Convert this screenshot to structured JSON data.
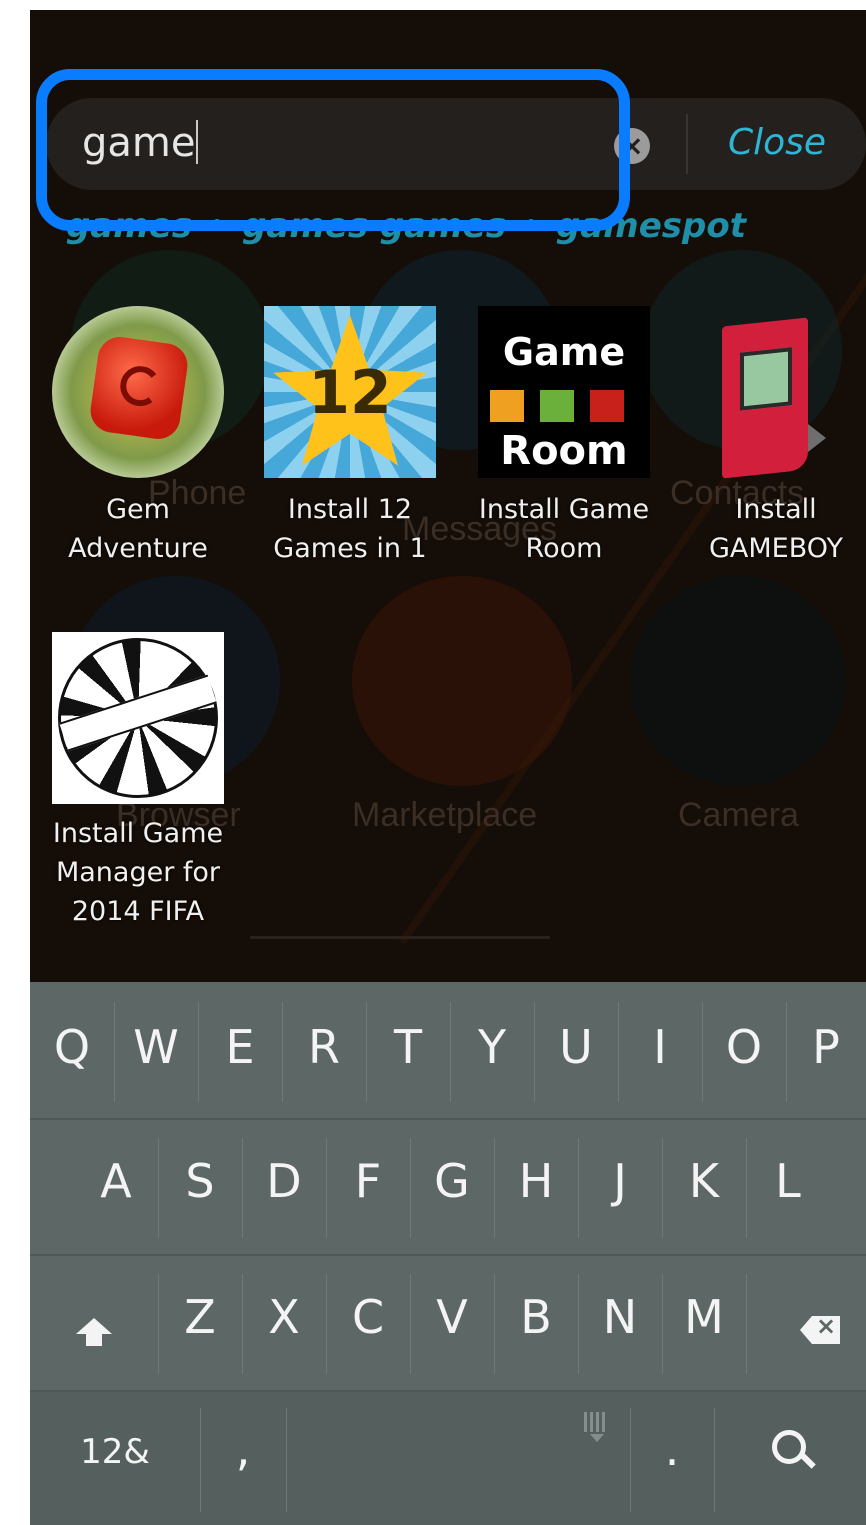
{
  "search": {
    "query": "game",
    "close_label": "Close"
  },
  "suggestions": [
    "games",
    "games games",
    "gamespot"
  ],
  "results": [
    {
      "line1": "Gem",
      "line2": "Adventure"
    },
    {
      "line1": "Install 12",
      "line2": "Games in 1"
    },
    {
      "line1": "Install Game",
      "line2": "Room"
    },
    {
      "line1": "Install",
      "line2": "GAMEBOY"
    },
    {
      "line1": "Install Game",
      "line2": "Manager for",
      "line3": "2014 FIFA"
    }
  ],
  "icons": {
    "game_room_line1": "Game",
    "game_room_line2": "Room",
    "star_number": "12"
  },
  "background_apps": [
    "Phone",
    "Messages",
    "Contacts",
    "Browser",
    "Marketplace",
    "Camera"
  ],
  "keyboard": {
    "row1": [
      "Q",
      "W",
      "E",
      "R",
      "T",
      "Y",
      "U",
      "I",
      "O",
      "P"
    ],
    "row2": [
      "A",
      "S",
      "D",
      "F",
      "G",
      "H",
      "J",
      "K",
      "L"
    ],
    "row3": [
      "Z",
      "X",
      "C",
      "V",
      "B",
      "N",
      "M"
    ],
    "symbols_label": "12&",
    "comma": ",",
    "period": "."
  },
  "colors": {
    "highlight": "#0a7cff",
    "accent": "#2eb6d6",
    "keyboard_bg": "#5d6866"
  }
}
